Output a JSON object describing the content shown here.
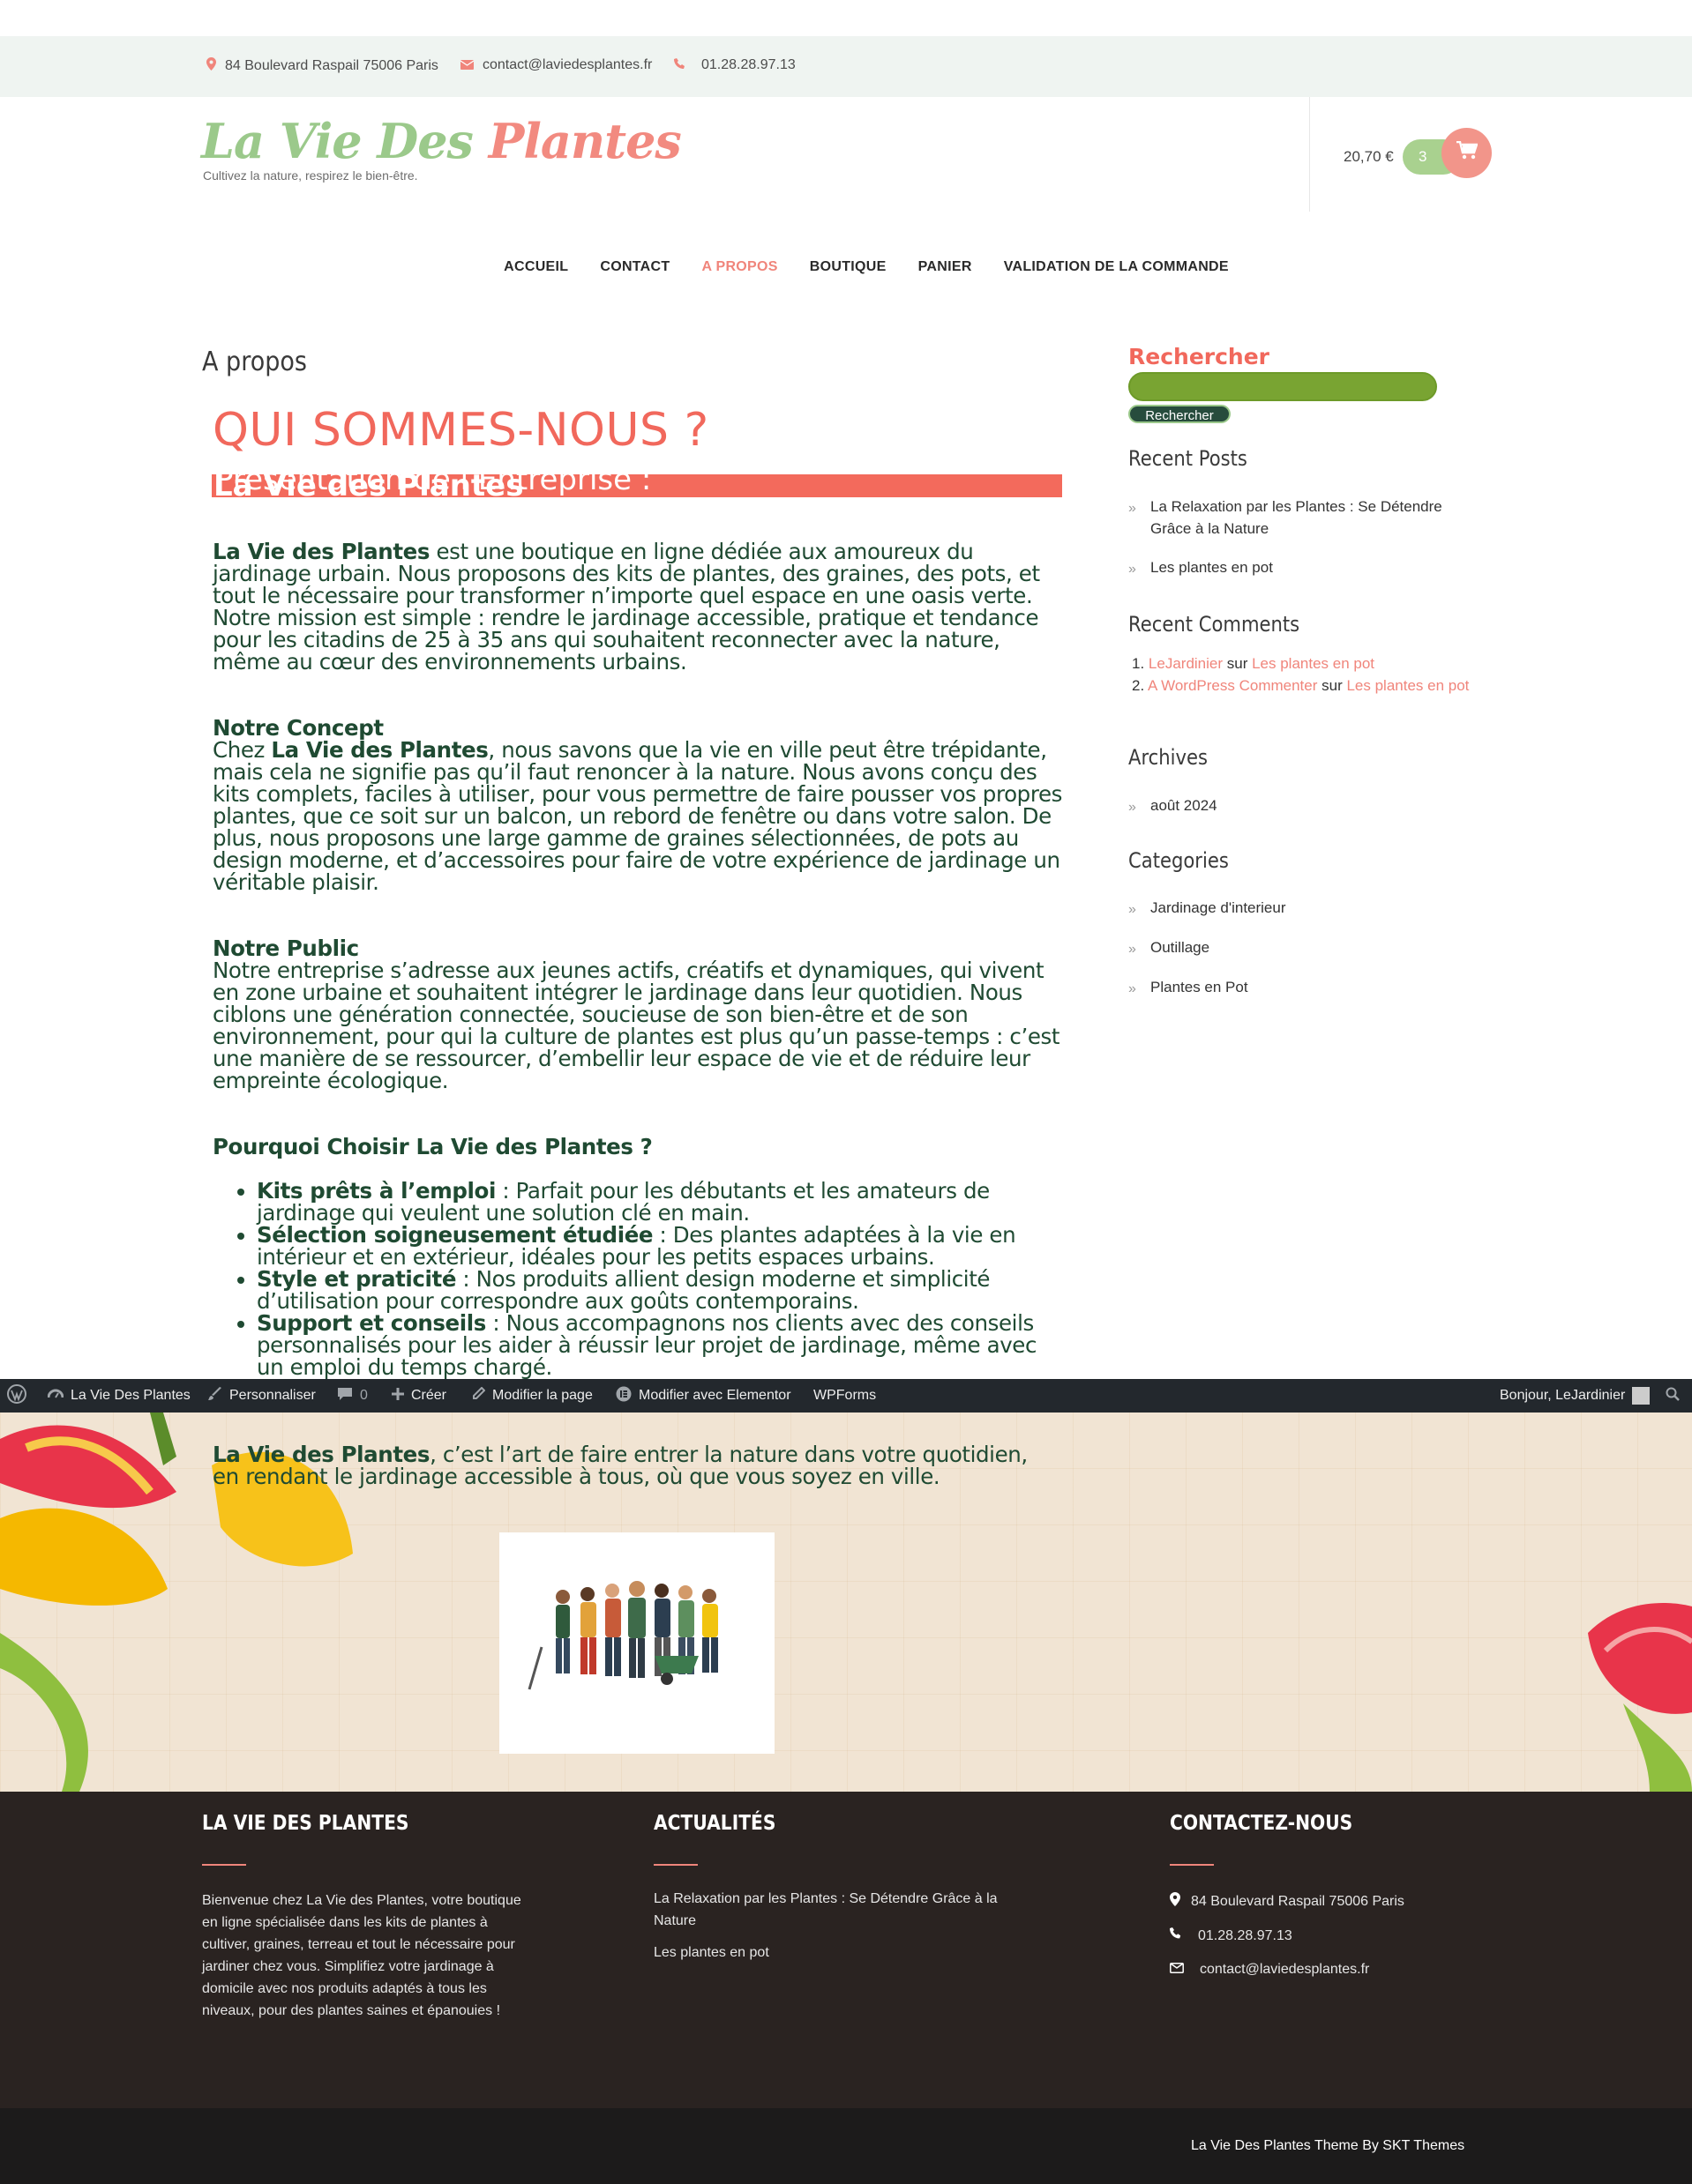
{
  "topbar": {
    "address": "84 Boulevard Raspail 75006 Paris",
    "email": "contact@laviedesplantes.fr",
    "phone": "01.28.28.97.13"
  },
  "header": {
    "logo_part1": "La Vie Des ",
    "logo_part2": "Plantes",
    "tagline": "Cultivez la nature, respirez le bien-être.",
    "cart_total": "20,70 €",
    "cart_count": "3"
  },
  "nav": {
    "items": [
      "ACCUEIL",
      "CONTACT",
      "A PROPOS",
      "BOUTIQUE",
      "PANIER",
      "VALIDATION DE LA COMMANDE"
    ],
    "active": "A PROPOS"
  },
  "main": {
    "page_title": "A propos",
    "heading": "QUI SOMMES-NOUS ?",
    "subheading_pre": "Présentation de l’Entreprise : ",
    "subheading_bold": "La Vie des Plantes",
    "intro_bold": "La Vie des Plantes",
    "intro_text": " est une boutique en ligne dédiée aux amoureux du jardinage urbain. Nous proposons des kits de plantes, des graines, des pots, et tout le nécessaire pour transformer n’importe quel espace en une oasis verte. Notre mission est simple : rendre le jardinage accessible, pratique et tendance pour les citadins de 25 à 35 ans qui souhaitent reconnecter avec la nature, même au cœur des environnements urbains.",
    "concept_title": "Notre Concept",
    "concept_pre": "Chez ",
    "concept_bold": "La Vie des Plantes",
    "concept_text": ", nous savons que la vie en ville peut être trépidante, mais cela ne signifie pas qu’il faut renoncer à la nature. Nous avons conçu des kits complets, faciles à utiliser, pour vous permettre de faire pousser vos propres plantes, que ce soit sur un balcon, un rebord de fenêtre ou dans votre salon. De plus, nous proposons une large gamme de graines sélectionnées, de pots au design moderne, et d’accessoires pour faire de votre expérience de jardinage un véritable plaisir.",
    "public_title": "Notre Public",
    "public_text": "Notre entreprise s’adresse aux jeunes actifs, créatifs et dynamiques, qui vivent en zone urbaine et souhaitent intégrer le jardinage dans leur quotidien. Nous ciblons une génération connectée, soucieuse de son bien-être et de son environnement, pour qui la culture de plantes est plus qu’un passe-temps : c’est une manière de se ressourcer, d’embellir leur espace de vie et de réduire leur empreinte écologique.",
    "why_title": "Pourquoi Choisir La Vie des Plantes ?",
    "why_items": [
      {
        "bold": "Kits prêts à l’emploi",
        "text": " : Parfait pour les débutants et les amateurs de jardinage qui veulent une solution clé en main."
      },
      {
        "bold": "Sélection soigneusement étudiée",
        "text": " : Des plantes adaptées à la vie en intérieur et en extérieur, idéales pour les petits espaces urbains."
      },
      {
        "bold": "Style et praticité",
        "text": " : Nos produits allient design moderne et simplicité d’utilisation pour correspondre aux goûts contemporains."
      },
      {
        "bold": "Support et conseils",
        "text": " : Nous accompagnons nos clients avec des conseils personnalisés pour les aider à réussir leur projet de jardinage, même avec un emploi du temps chargé."
      }
    ],
    "closing_bold": "La Vie des Plantes",
    "closing_text": ", c’est l’art de faire entrer la nature dans votre quotidien, en rendant le jardinage accessible à tous, où que vous soyez en ville."
  },
  "sidebar": {
    "search_title": "Rechercher",
    "search_button": "Rechercher",
    "recent_posts_title": "Recent Posts",
    "recent_posts": [
      "La Relaxation par les Plantes : Se Détendre Grâce à la Nature",
      "Les plantes en pot"
    ],
    "recent_comments_title": "Recent Comments",
    "comments": [
      {
        "num": "1.",
        "author": "LeJardinier",
        "sep": " sur ",
        "post": "Les plantes en pot"
      },
      {
        "num": "2.",
        "author": "A WordPress Commenter",
        "sep": " sur ",
        "post": "Les plantes en pot"
      }
    ],
    "archives_title": "Archives",
    "archives": [
      "août 2024"
    ],
    "categories_title": "Categories",
    "categories": [
      "Jardinage d'interieur",
      "Outillage",
      "Plantes en Pot"
    ]
  },
  "adminbar": {
    "site": "La Vie Des Plantes",
    "customize": "Personnaliser",
    "comments_count": "0",
    "new": "Créer",
    "edit_page": "Modifier la page",
    "elementor": "Modifier avec Elementor",
    "wpforms": "WPForms",
    "greeting": "Bonjour, LeJardinier"
  },
  "footer": {
    "col1_title": "LA VIE DES PLANTES",
    "col1_text": "Bienvenue chez La Vie des Plantes, votre boutique en ligne spécialisée dans les kits de plantes à cultiver, graines, terreau et tout le nécessaire pour jardiner chez vous. Simplifiez votre jardinage à domicile avec nos produits adaptés à tous les niveaux, pour des plantes saines et épanouies !",
    "col2_title": "ACTUALITÉS",
    "col2_links": [
      "La Relaxation par les Plantes : Se Détendre Grâce à la Nature",
      "Les plantes en pot"
    ],
    "col3_title": "CONTACTEZ-NOUS",
    "address": "84 Boulevard Raspail 75006 Paris",
    "phone": "01.28.28.97.13",
    "email": "contact@laviedesplantes.fr",
    "credit": "La Vie Des Plantes Theme By SKT Themes"
  },
  "colors": {
    "accent": "#f0857b",
    "green_logo": "#9bc98b",
    "text_green": "#1f4a32",
    "heading_red": "#f1685c",
    "search_green": "#79a432"
  }
}
